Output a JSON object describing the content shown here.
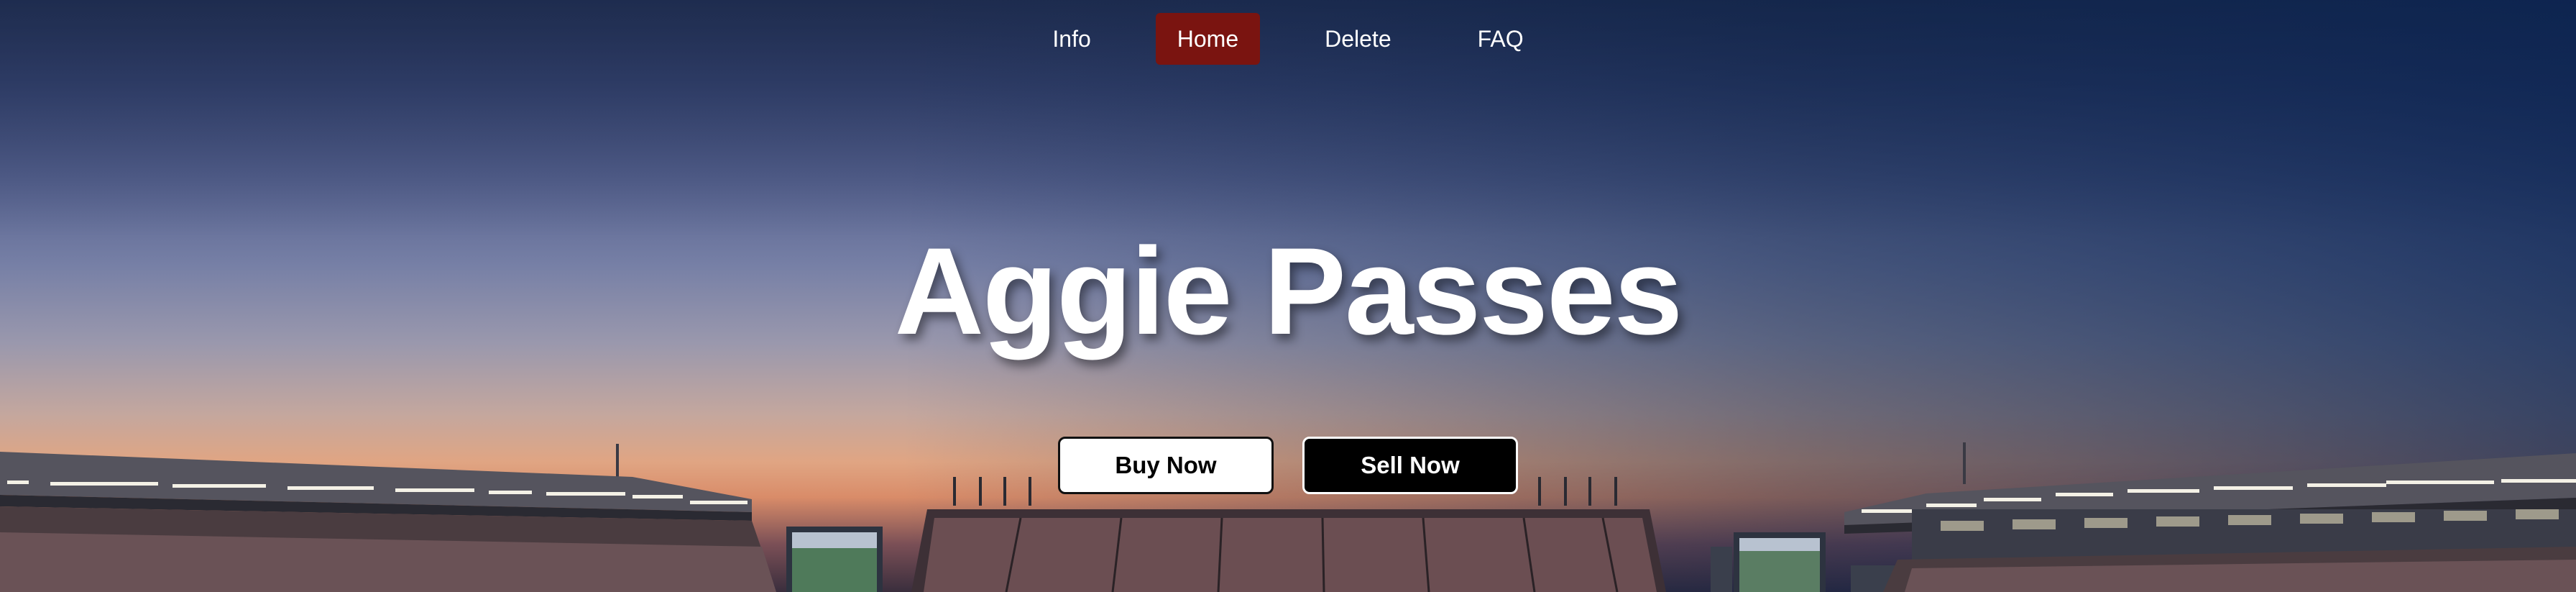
{
  "nav": {
    "items": [
      {
        "label": "Info",
        "active": false
      },
      {
        "label": "Home",
        "active": true
      },
      {
        "label": "Delete",
        "active": false
      },
      {
        "label": "FAQ",
        "active": false
      }
    ],
    "active_color": "#7a1410"
  },
  "hero": {
    "title": "Aggie Passes",
    "buy_label": "Buy Now",
    "sell_label": "Sell Now"
  }
}
